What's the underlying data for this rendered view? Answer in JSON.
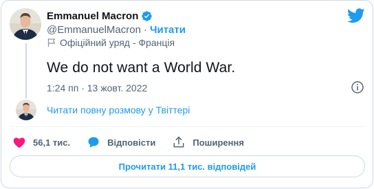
{
  "author": {
    "name": "Emmanuel Macron",
    "handle": "@EmmanuelMacron",
    "separator": "·",
    "follow_label": "Читати",
    "affiliation": "Офіційний уряд - Франція"
  },
  "tweet": {
    "text": "We do not want a World War.",
    "timestamp": "1:24 пп · 13 жовт. 2022"
  },
  "thread": {
    "read_full_label": "Читати повну розмову у Твіттері"
  },
  "actions": {
    "likes": "56,1 тис.",
    "reply_label": "Відповісти",
    "share_label": "Поширення"
  },
  "replies_button_label": "Прочитати 11,1 тис. відповідей",
  "icons": {
    "twitter": "twitter-bird-icon",
    "verified": "verified-badge-icon",
    "flag": "flag-icon",
    "info": "info-icon",
    "like": "heart-icon",
    "reply": "reply-bubble-icon",
    "share": "share-icon"
  },
  "colors": {
    "accent": "#1d9bf0",
    "like": "#f91880",
    "muted": "#536471",
    "text": "#0f1419"
  }
}
